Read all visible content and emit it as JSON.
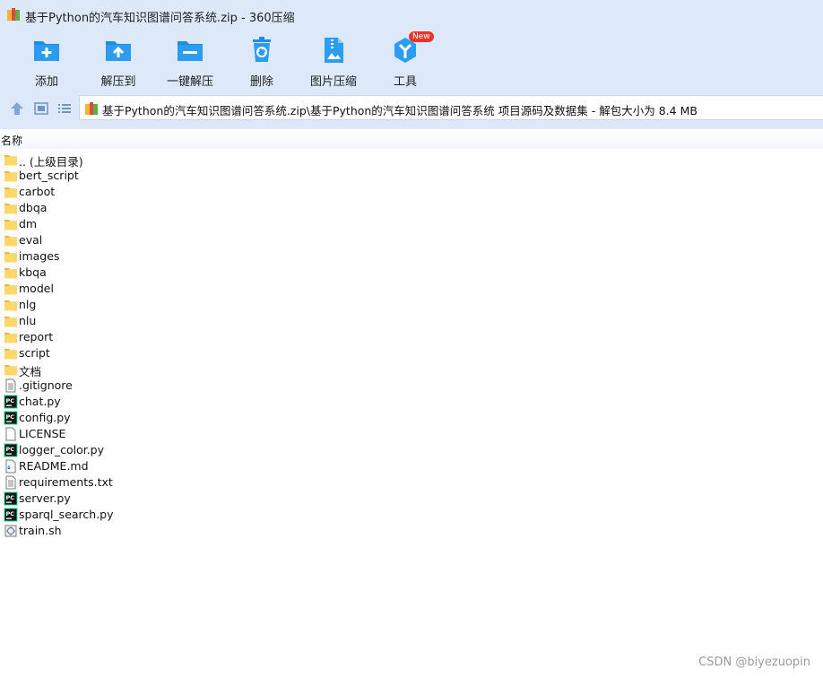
{
  "window": {
    "title": "基于Python的汽车知识图谱问答系统.zip - 360压缩"
  },
  "toolbar": {
    "items": [
      {
        "label": "添加",
        "icon": "add-icon"
      },
      {
        "label": "解压到",
        "icon": "extract-to-icon"
      },
      {
        "label": "一键解压",
        "icon": "one-click-extract-icon"
      },
      {
        "label": "删除",
        "icon": "delete-icon"
      },
      {
        "label": "图片压缩",
        "icon": "image-compress-icon"
      },
      {
        "label": "工具",
        "icon": "tools-icon",
        "badge": "New"
      }
    ]
  },
  "address": {
    "path": "基于Python的汽车知识图谱问答系统.zip\\基于Python的汽车知识图谱问答系统 项目源码及数据集 - 解包大小为 8.4 MB"
  },
  "list": {
    "column_name": "名称",
    "items": [
      {
        "name": ".. (上级目录)",
        "type": "folder"
      },
      {
        "name": "bert_script",
        "type": "folder"
      },
      {
        "name": "carbot",
        "type": "folder"
      },
      {
        "name": "dbqa",
        "type": "folder"
      },
      {
        "name": "dm",
        "type": "folder"
      },
      {
        "name": "eval",
        "type": "folder"
      },
      {
        "name": "images",
        "type": "folder"
      },
      {
        "name": "kbqa",
        "type": "folder"
      },
      {
        "name": "model",
        "type": "folder"
      },
      {
        "name": "nlg",
        "type": "folder"
      },
      {
        "name": "nlu",
        "type": "folder"
      },
      {
        "name": "report",
        "type": "folder"
      },
      {
        "name": "script",
        "type": "folder"
      },
      {
        "name": "文档",
        "type": "folder"
      },
      {
        "name": ".gitignore",
        "type": "text"
      },
      {
        "name": "chat.py",
        "type": "python"
      },
      {
        "name": "config.py",
        "type": "python"
      },
      {
        "name": "LICENSE",
        "type": "blank"
      },
      {
        "name": "logger_color.py",
        "type": "python"
      },
      {
        "name": "README.md",
        "type": "markdown"
      },
      {
        "name": "requirements.txt",
        "type": "text"
      },
      {
        "name": "server.py",
        "type": "python"
      },
      {
        "name": "sparql_search.py",
        "type": "python"
      },
      {
        "name": "train.sh",
        "type": "shell"
      }
    ]
  },
  "watermark": "CSDN @biyezuopin",
  "colors": {
    "chrome_bg": "#dde9f8",
    "icon_blue": "#1a8ee8",
    "folder_yellow": "#ffd86b",
    "badge_red": "#e8352b"
  }
}
